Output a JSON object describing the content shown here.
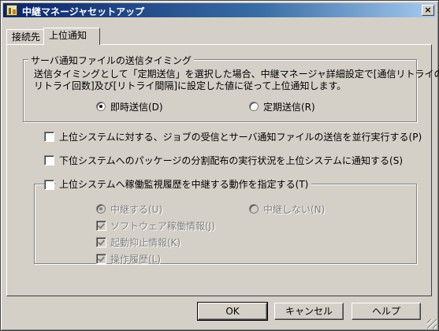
{
  "window": {
    "title": "中継マネージャセットアップ",
    "close_label": "×"
  },
  "tabs": [
    {
      "label": "接続先"
    },
    {
      "label": "上位通知"
    }
  ],
  "timing_group": {
    "legend": "サーバ通知ファイルの送信タイミング",
    "description_line1": "送信タイミングとして「定期送信」を選択した場合、中継マネージャ詳細設定で[通信リトライの",
    "description_line2": "リトライ回数]及び[リトライ間隔]に設定した値に従って上位通知します。",
    "options": [
      {
        "label": "即時送信(D)",
        "selected": true
      },
      {
        "label": "定期送信(R)",
        "selected": false
      }
    ]
  },
  "checks": {
    "parallel": {
      "label": "上位システムに対する、ジョブの受信とサーバ通知ファイルの送信を並行実行する(P)",
      "checked": false
    },
    "notify": {
      "label": "下位システムへのパッケージの分割配布の実行状況を上位システムに通知する(S)",
      "checked": false
    }
  },
  "monitor_group": {
    "legend": "上位システムへ稼働監視履歴を中継する動作を指定する(T)",
    "checked": false,
    "relay_options": [
      {
        "label": "中継する(U)",
        "selected": true
      },
      {
        "label": "中継しない(N)",
        "selected": false
      }
    ],
    "items": [
      {
        "label": "ソフトウェア稼働情報(J)",
        "checked": true
      },
      {
        "label": "起動抑止情報(K)",
        "checked": true
      },
      {
        "label": "操作履歴(L)",
        "checked": true
      }
    ]
  },
  "buttons": {
    "ok": "OK",
    "cancel": "キャンセル",
    "help": "ヘルプ"
  }
}
